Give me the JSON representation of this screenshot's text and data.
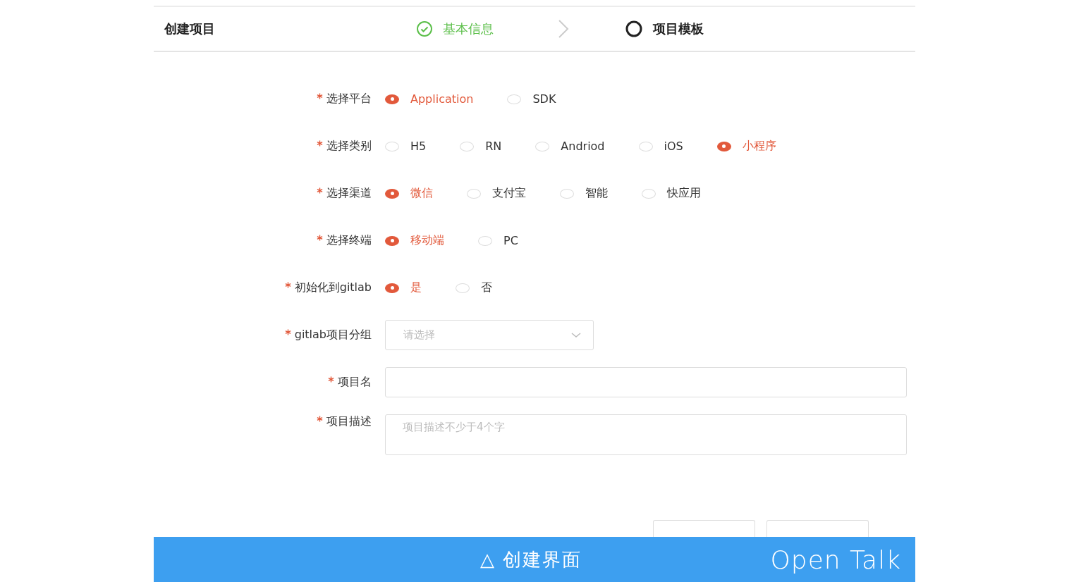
{
  "header": {
    "title": "创建项目",
    "steps": [
      {
        "label": "基本信息",
        "completed": true
      },
      {
        "label": "项目模板",
        "completed": false
      }
    ]
  },
  "form": {
    "fields": [
      {
        "kind": "radio",
        "label": "选择平台",
        "required": true,
        "options": [
          {
            "label": "Application",
            "selected": true
          },
          {
            "label": "SDK",
            "selected": false
          }
        ]
      },
      {
        "kind": "radio",
        "label": "选择类别",
        "required": true,
        "options": [
          {
            "label": "H5",
            "selected": false
          },
          {
            "label": "RN",
            "selected": false
          },
          {
            "label": "Andriod",
            "selected": false
          },
          {
            "label": "iOS",
            "selected": false
          },
          {
            "label": "小程序",
            "selected": true
          }
        ]
      },
      {
        "kind": "radio",
        "label": "选择渠道",
        "required": true,
        "options": [
          {
            "label": "微信",
            "selected": true
          },
          {
            "label": "支付宝",
            "selected": false
          },
          {
            "label": "智能",
            "selected": false
          },
          {
            "label": "快应用",
            "selected": false
          }
        ]
      },
      {
        "kind": "radio",
        "label": "选择终端",
        "required": true,
        "options": [
          {
            "label": "移动端",
            "selected": true
          },
          {
            "label": "PC",
            "selected": false
          }
        ]
      },
      {
        "kind": "radio",
        "label": "初始化到gitlab",
        "required": true,
        "options": [
          {
            "label": "是",
            "selected": true
          },
          {
            "label": "否",
            "selected": false
          }
        ]
      },
      {
        "kind": "select",
        "label": "gitlab项目分组",
        "required": true,
        "placeholder": "请选择"
      },
      {
        "kind": "input",
        "label": "项目名",
        "required": true
      },
      {
        "kind": "textarea",
        "label": "项目描述",
        "required": true,
        "placeholder": "项目描述不少于4个字"
      }
    ]
  },
  "buttons": [
    {
      "kind": "outline"
    },
    {
      "kind": "outline"
    }
  ],
  "caption": {
    "title": "△ 创建界面",
    "logo": "Open Talk"
  }
}
